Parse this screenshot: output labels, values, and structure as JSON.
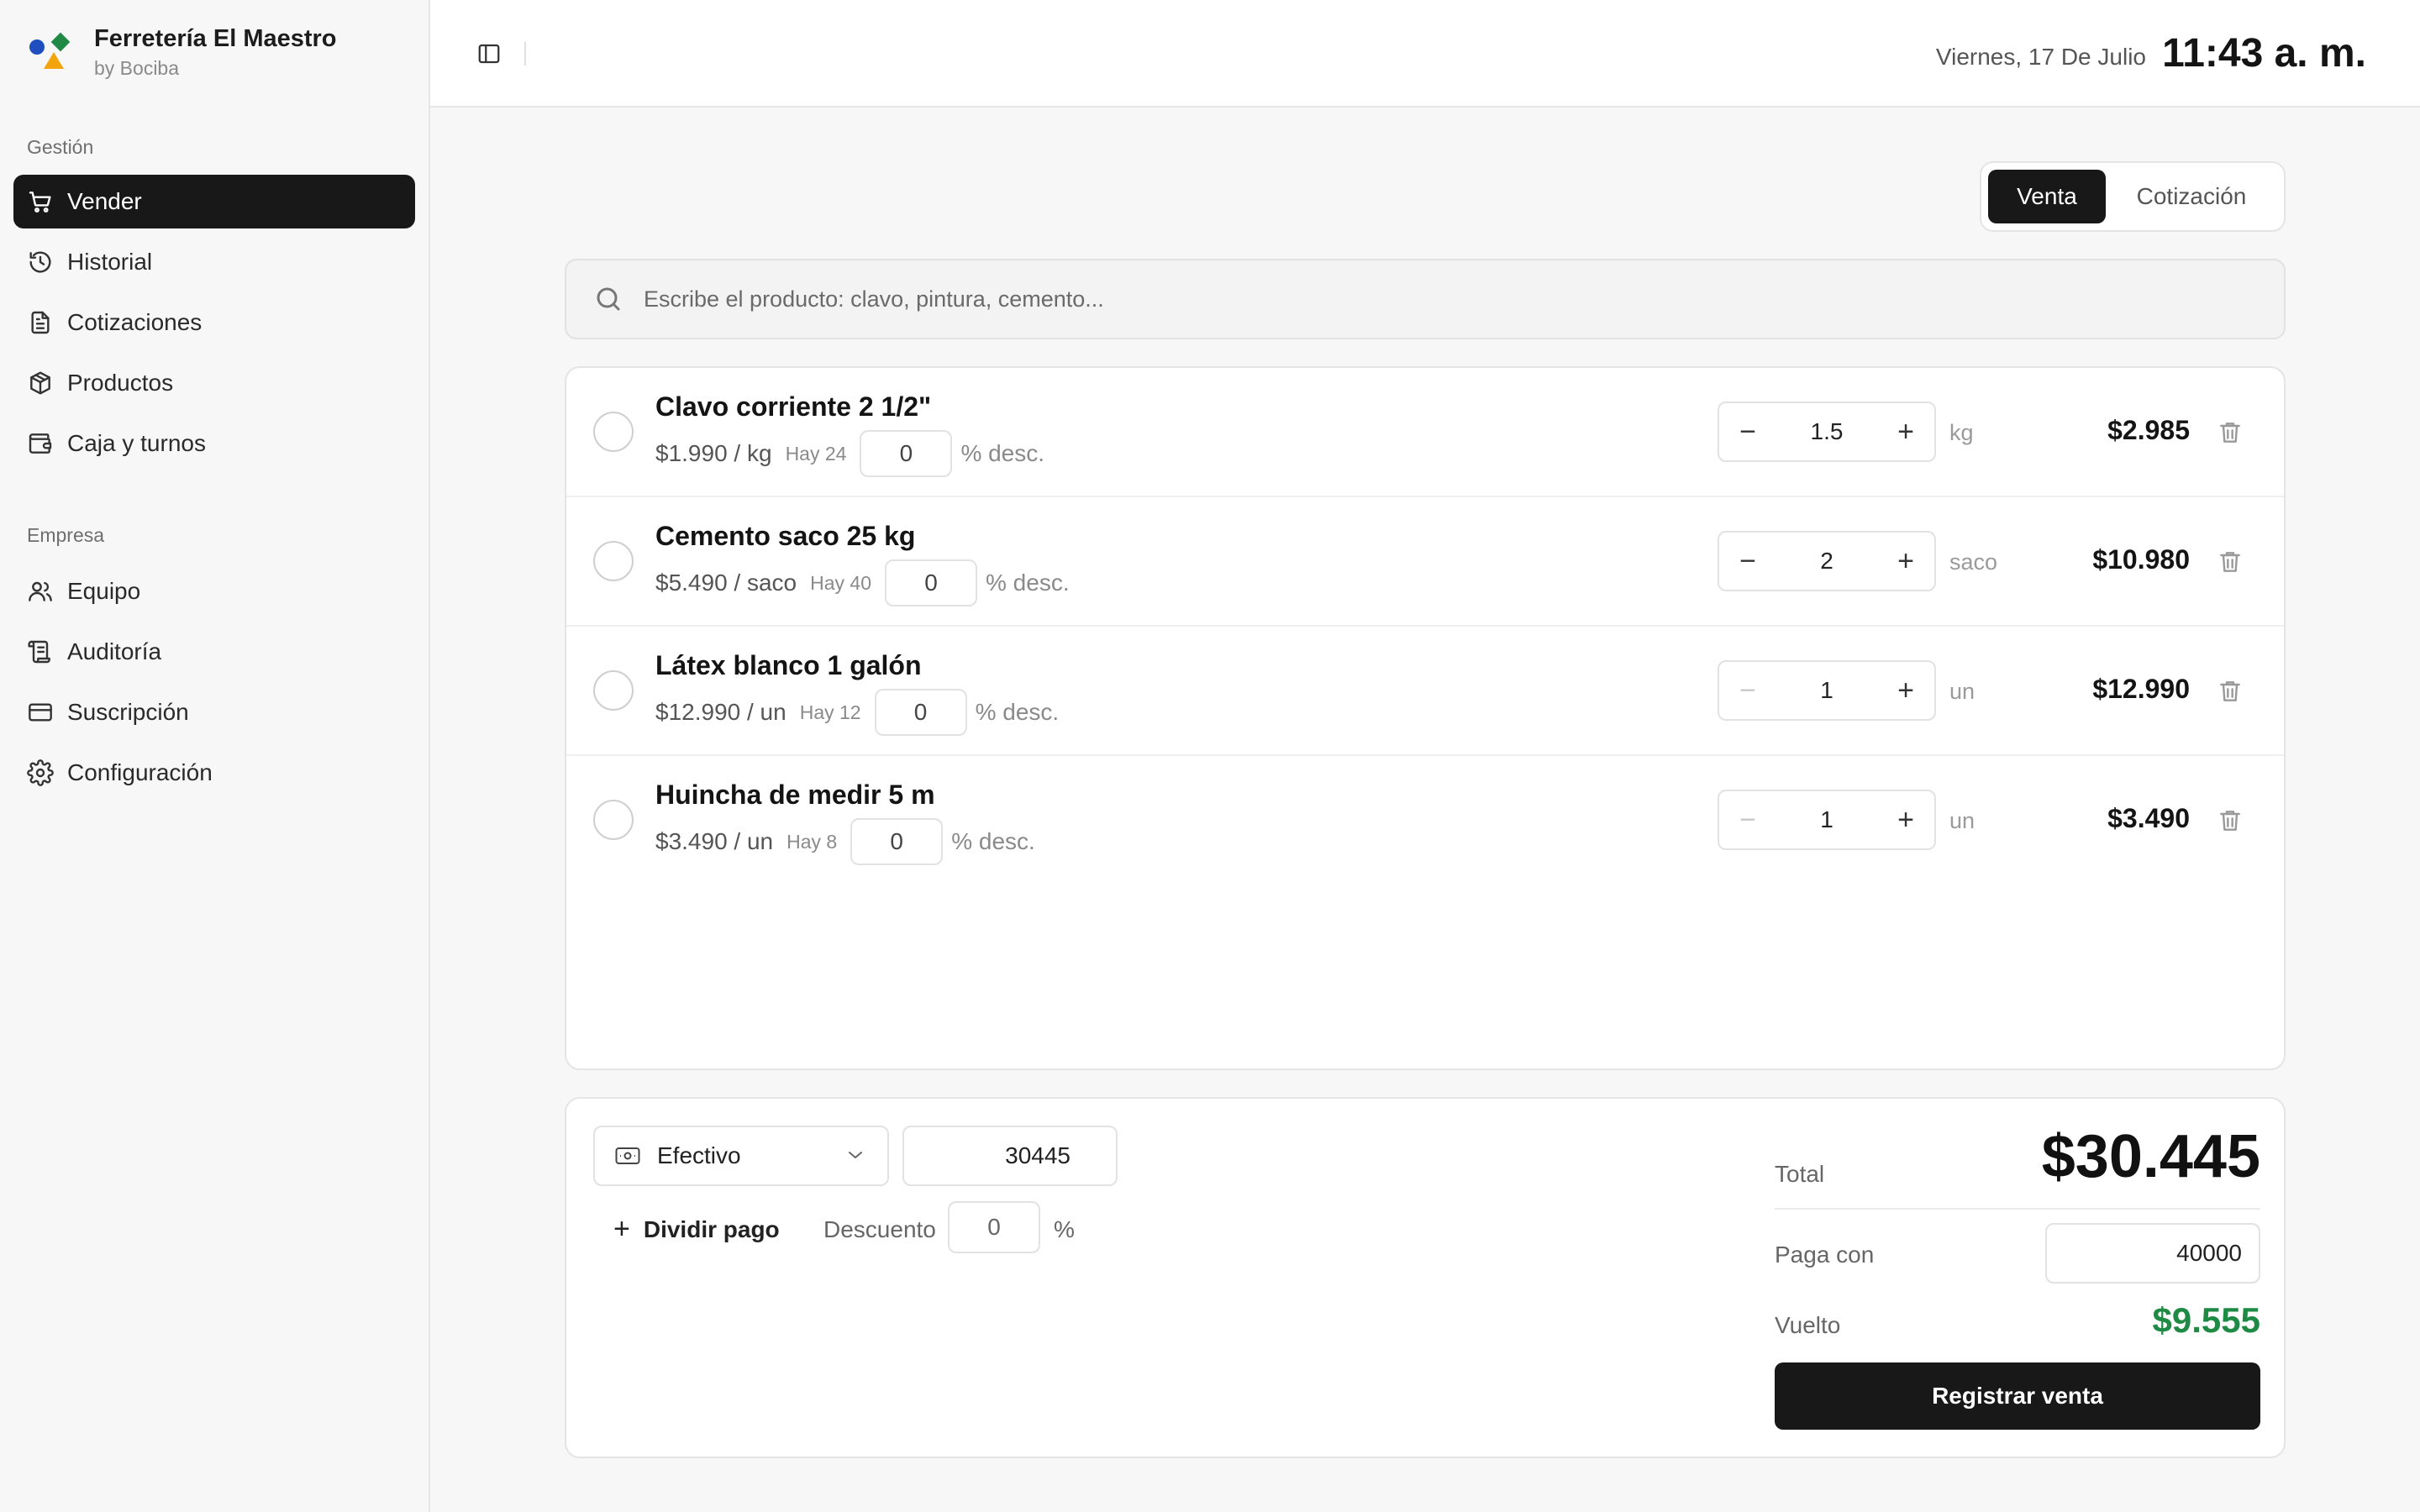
{
  "brand": {
    "title": "Ferretería El Maestro",
    "subtitle": "by Bociba"
  },
  "sidebar": {
    "sections": [
      {
        "label": "Gestión",
        "items": [
          {
            "label": "Vender",
            "icon": "cart-icon",
            "active": true
          },
          {
            "label": "Historial",
            "icon": "history-icon"
          },
          {
            "label": "Cotizaciones",
            "icon": "document-icon"
          },
          {
            "label": "Productos",
            "icon": "box-icon"
          },
          {
            "label": "Caja y turnos",
            "icon": "wallet-icon"
          }
        ]
      },
      {
        "label": "Empresa",
        "items": [
          {
            "label": "Equipo",
            "icon": "users-icon"
          },
          {
            "label": "Auditoría",
            "icon": "scroll-icon"
          },
          {
            "label": "Suscripción",
            "icon": "credit-card-icon"
          },
          {
            "label": "Configuración",
            "icon": "gear-icon"
          }
        ]
      }
    ]
  },
  "header": {
    "date": "Viernes, 17 De Julio",
    "time": "11:43 a. m."
  },
  "mode": {
    "active": "Venta",
    "inactive": "Cotización"
  },
  "search": {
    "placeholder": "Escribe el producto: clavo, pintura, cemento..."
  },
  "cart": {
    "items": [
      {
        "name": "Clavo corriente 2 1/2\"",
        "price": "$1.990 / kg",
        "stock": "Hay 24",
        "discount": "0",
        "discount_label": "% desc.",
        "qty": "1.5",
        "unit": "kg",
        "subtotal": "$2.985",
        "minus_enabled": true
      },
      {
        "name": "Cemento saco 25 kg",
        "price": "$5.490 / saco",
        "stock": "Hay 40",
        "discount": "0",
        "discount_label": "% desc.",
        "qty": "2",
        "unit": "saco",
        "subtotal": "$10.980",
        "minus_enabled": true
      },
      {
        "name": "Látex blanco 1 galón",
        "price": "$12.990 / un",
        "stock": "Hay 12",
        "discount": "0",
        "discount_label": "% desc.",
        "qty": "1",
        "unit": "un",
        "subtotal": "$12.990",
        "minus_enabled": false
      },
      {
        "name": "Huincha de medir 5 m",
        "price": "$3.490 / un",
        "stock": "Hay 8",
        "discount": "0",
        "discount_label": "% desc.",
        "qty": "1",
        "unit": "un",
        "subtotal": "$3.490",
        "minus_enabled": false
      }
    ]
  },
  "payment": {
    "method": "Efectivo",
    "amount": "30445",
    "split_label": "Dividir pago",
    "discount_label": "Descuento",
    "discount_value": "0",
    "discount_pct": "%",
    "total_label": "Total",
    "total_value": "$30.445",
    "paga_label": "Paga con",
    "paga_value": "40000",
    "vuelto_label": "Vuelto",
    "vuelto_value": "$9.555",
    "register_label": "Registrar venta"
  },
  "colors": {
    "accent": "#181818",
    "positive": "#1f8a44"
  }
}
